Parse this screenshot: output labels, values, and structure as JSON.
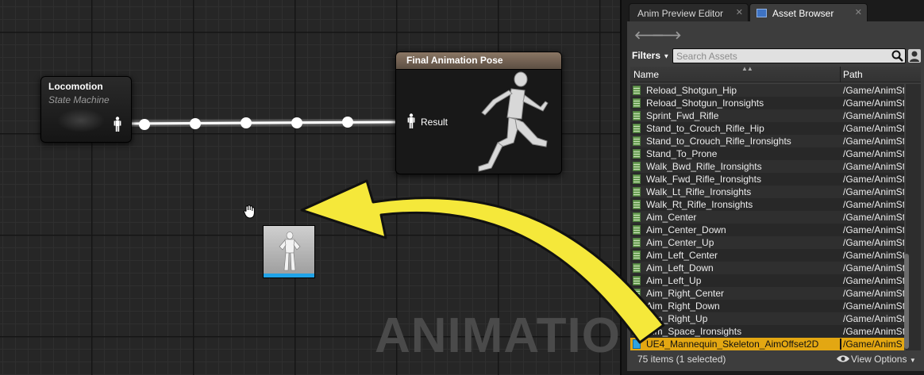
{
  "graph": {
    "watermark": "ANIMATION",
    "locomotion_node": {
      "title": "Locomotion",
      "subtitle": "State Machine"
    },
    "final_node": {
      "title": "Final Animation Pose",
      "result_label": "Result"
    }
  },
  "tabs": [
    {
      "label": "Anim Preview Editor",
      "close": "✕"
    },
    {
      "label": "Asset Browser",
      "close": "✕",
      "icon": "asset-browser-icon"
    }
  ],
  "asset_browser": {
    "back": "🡐",
    "forward": "🡒",
    "filters_label": "Filters",
    "filters_caret": "▼",
    "search_placeholder": "Search Assets",
    "columns": {
      "name": "Name",
      "path": "Path",
      "sort": "▲▲"
    },
    "rows": [
      {
        "name": "Reload_Shotgun_Hip",
        "path": "/Game/AnimStarterPack"
      },
      {
        "name": "Reload_Shotgun_Ironsights",
        "path": "/Game/AnimStarterPack"
      },
      {
        "name": "Sprint_Fwd_Rifle",
        "path": "/Game/AnimStarterPack"
      },
      {
        "name": "Stand_to_Crouch_Rifle_Hip",
        "path": "/Game/AnimStarterPack"
      },
      {
        "name": "Stand_to_Crouch_Rifle_Ironsights",
        "path": "/Game/AnimStarterPack"
      },
      {
        "name": "Stand_To_Prone",
        "path": "/Game/AnimStarterPack"
      },
      {
        "name": "Walk_Bwd_Rifle_Ironsights",
        "path": "/Game/AnimStarterPack"
      },
      {
        "name": "Walk_Fwd_Rifle_Ironsights",
        "path": "/Game/AnimStarterPack"
      },
      {
        "name": "Walk_Lt_Rifle_Ironsights",
        "path": "/Game/AnimStarterPack"
      },
      {
        "name": "Walk_Rt_Rifle_Ironsights",
        "path": "/Game/AnimStarterPack"
      },
      {
        "name": "Aim_Center",
        "path": "/Game/AnimStarterPack"
      },
      {
        "name": "Aim_Center_Down",
        "path": "/Game/AnimStarterPack"
      },
      {
        "name": "Aim_Center_Up",
        "path": "/Game/AnimStarterPack"
      },
      {
        "name": "Aim_Left_Center",
        "path": "/Game/AnimStarterPack"
      },
      {
        "name": "Aim_Left_Down",
        "path": "/Game/AnimStarterPack"
      },
      {
        "name": "Aim_Left_Up",
        "path": "/Game/AnimStarterPack"
      },
      {
        "name": "Aim_Right_Center",
        "path": "/Game/AnimStarterPack"
      },
      {
        "name": "Aim_Right_Down",
        "path": "/Game/AnimStarterPack"
      },
      {
        "name": "Aim_Right_Up",
        "path": "/Game/AnimStarterPack"
      },
      {
        "name": "Aim_Space_Ironsights",
        "path": "/Game/AnimStarterPack"
      },
      {
        "name": "UE4_Mannequin_Skeleton_AimOffset2D",
        "path": "/Game/AnimStarterPack",
        "selected": true
      }
    ],
    "status": "75 items (1 selected)",
    "view_options": "View Options",
    "view_caret": "▼"
  },
  "colors": {
    "selection": "#e3a712",
    "arrow": "#f5e83a",
    "thumb_bar": "#1fa3e8"
  }
}
